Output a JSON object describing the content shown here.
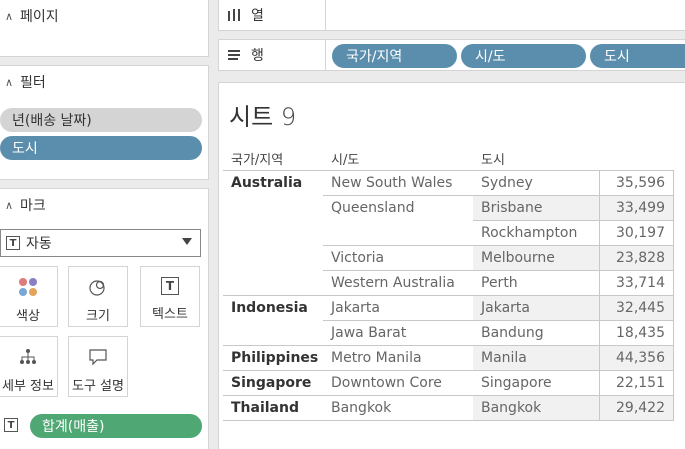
{
  "left": {
    "pages": {
      "title": "페이지"
    },
    "filters": {
      "title": "필터",
      "items": [
        "년(배송 날짜)",
        "도시"
      ]
    },
    "marks": {
      "title": "마크",
      "type_selected": "자동",
      "buttons": [
        "색상",
        "크기",
        "텍스트",
        "세부 정보",
        "도구 설명"
      ],
      "measure_pill": "합계(매출)"
    }
  },
  "shelves": {
    "columns_label": "열",
    "rows_label": "행",
    "rows_pills": [
      "국가/지역",
      "시/도",
      "도시"
    ]
  },
  "sheet": {
    "title_word": "시트",
    "title_num": "9",
    "headers": {
      "country": "국가/지역",
      "state": "시/도",
      "city": "도시"
    },
    "rows": [
      {
        "country": "Australia",
        "state": "New South Wales",
        "city": "Sydney",
        "value": "35,596"
      },
      {
        "country": "",
        "state": "Queensland",
        "city": "Brisbane",
        "value": "33,499"
      },
      {
        "country": "",
        "state": "",
        "city": "Rockhampton",
        "value": "30,197"
      },
      {
        "country": "",
        "state": "Victoria",
        "city": "Melbourne",
        "value": "23,828"
      },
      {
        "country": "",
        "state": "Western Australia",
        "city": "Perth",
        "value": "33,714"
      },
      {
        "country": "Indonesia",
        "state": "Jakarta",
        "city": "Jakarta",
        "value": "32,445"
      },
      {
        "country": "",
        "state": "Jawa Barat",
        "city": "Bandung",
        "value": "18,435"
      },
      {
        "country": "Philippines",
        "state": "Metro Manila",
        "city": "Manila",
        "value": "44,356"
      },
      {
        "country": "Singapore",
        "state": "Downtown Core",
        "city": "Singapore",
        "value": "22,151"
      },
      {
        "country": "Thailand",
        "state": "Bangkok",
        "city": "Bangkok",
        "value": "29,422"
      }
    ]
  },
  "colors": {
    "pill_blue": "#5b8ead",
    "pill_green": "#4fa873",
    "pill_gray": "#d4d4d4"
  },
  "icons": [
    "caret-up-icon",
    "columns-icon",
    "rows-icon",
    "text-mark-icon",
    "color-icon",
    "size-icon",
    "detail-icon",
    "tooltip-icon",
    "dropdown-arrow-icon"
  ]
}
